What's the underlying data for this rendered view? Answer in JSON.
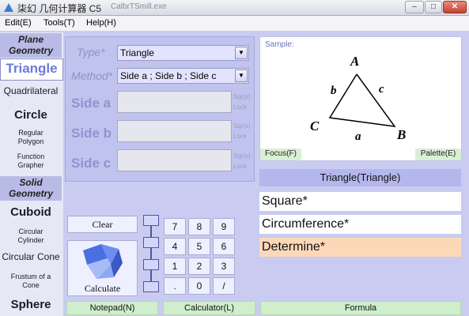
{
  "window": {
    "title": "柒幻 几何计算器 C5",
    "blurred_text": "CalbrTSmill.exe",
    "minimize": "–",
    "maximize": "□",
    "close": "✕"
  },
  "menu": [
    "Edit(E)",
    "Tools(T)",
    "Help(H)"
  ],
  "nav": {
    "plane_header_1": "Plane",
    "plane_header_2": "Geometry",
    "triangle": "Triangle",
    "quadrilateral": "Quadrilateral",
    "circle": "Circle",
    "regular_polygon_1": "Regular",
    "regular_polygon_2": "Polygon",
    "function_grapher_1": "Function",
    "function_grapher_2": "Grapher",
    "solid_header_1": "Solid",
    "solid_header_2": "Geometry",
    "cuboid": "Cuboid",
    "circular_cylinder_1": "Circular",
    "circular_cylinder_2": "Cylinder",
    "circular_cone": "Circular Cone",
    "frustum_1": "Frustum of a",
    "frustum_2": "Cone",
    "sphere": "Sphere"
  },
  "params": {
    "type_label": "Type*",
    "type_value": "Triangle",
    "method_label": "Method*",
    "method_value": "Side a ; Side b ; Side c",
    "side_a_label": "Side a",
    "side_b_label": "Side b",
    "side_c_label": "Side c",
    "sqr_label": "Sqr(x)",
    "lock_label": "Lock"
  },
  "sample": {
    "label": "Sample:",
    "vertex_a": "A",
    "vertex_b": "B",
    "vertex_c": "C",
    "side_a": "a",
    "side_b": "b",
    "side_c": "c",
    "focus": "Focus(F)",
    "palette": "Palette(E)"
  },
  "shape_title": "Triangle(Triangle)",
  "results": {
    "square": "Square*",
    "circumference": "Circumference*",
    "determine": "Determine*"
  },
  "calculator": {
    "clear": "Clear",
    "calculate": "Calculate",
    "keys": [
      "7",
      "8",
      "9",
      "4",
      "5",
      "6",
      "1",
      "2",
      "3",
      ".",
      "0",
      "/"
    ]
  },
  "bottom": {
    "notepad": "Notepad(N)",
    "calc": "Calculator(L)",
    "formula": "Formula"
  },
  "colors": {
    "accent": "#6c7ad8",
    "window_bg": "#c9ccf0",
    "determine_bg": "#fcd8b9"
  }
}
